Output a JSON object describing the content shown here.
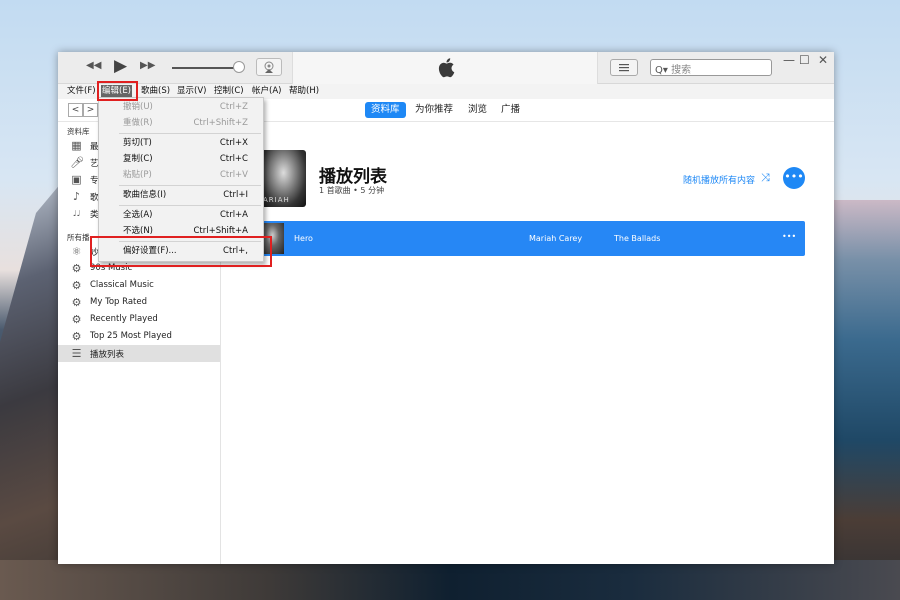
{
  "window": {
    "search_placeholder": "搜索",
    "apple_logo": "",
    "controls": {
      "minimize": "—",
      "maximize": "☐",
      "close": "✕"
    }
  },
  "playback": {
    "prev_icon": "◀◀",
    "play_icon": "▶",
    "next_icon": "▶▶",
    "volume": 1.0
  },
  "menubar": {
    "items": [
      {
        "label": "文件(F)"
      },
      {
        "label": "编辑(E)",
        "active": true
      },
      {
        "label": "歌曲(S)"
      },
      {
        "label": "显示(V)"
      },
      {
        "label": "控制(C)"
      },
      {
        "label": "帐户(A)"
      },
      {
        "label": "帮助(H)"
      }
    ]
  },
  "edit_menu": {
    "items": [
      {
        "label": "撤销(U)",
        "shortcut": "Ctrl+Z",
        "disabled": true
      },
      {
        "label": "重做(R)",
        "shortcut": "Ctrl+Shift+Z",
        "disabled": true
      },
      {
        "label": "剪切(T)",
        "shortcut": "Ctrl+X",
        "disabled": false
      },
      {
        "label": "复制(C)",
        "shortcut": "Ctrl+C",
        "disabled": false
      },
      {
        "label": "粘贴(P)",
        "shortcut": "Ctrl+V",
        "disabled": true
      },
      {
        "label": "歌曲信息(I)",
        "shortcut": "Ctrl+I",
        "disabled": false
      },
      {
        "label": "全选(A)",
        "shortcut": "Ctrl+A",
        "disabled": false
      },
      {
        "label": "不选(N)",
        "shortcut": "Ctrl+Shift+A",
        "disabled": false
      },
      {
        "label": "偏好设置(F)...",
        "shortcut": "Ctrl+,",
        "disabled": false
      }
    ]
  },
  "nav": {
    "back": "<",
    "forward": ">",
    "tabs": [
      {
        "label": "资料库",
        "active": true
      },
      {
        "label": "为你推荐"
      },
      {
        "label": "浏览"
      },
      {
        "label": "广播"
      }
    ]
  },
  "sidebar": {
    "library_heading": "资料库",
    "library_items": [
      {
        "icon": "grid-icon",
        "label": "最"
      },
      {
        "icon": "microphone-icon",
        "label": "艺"
      },
      {
        "icon": "album-icon",
        "label": "专"
      },
      {
        "icon": "music-note-icon",
        "label": "歌"
      },
      {
        "icon": "genre-icon",
        "label": "类"
      }
    ],
    "playlists_heading": "所有播",
    "playlists": [
      {
        "icon": "genius-icon",
        "label": "妙"
      },
      {
        "icon": "gear-icon",
        "label": "90s Music"
      },
      {
        "icon": "gear-icon",
        "label": "Classical Music"
      },
      {
        "icon": "gear-icon",
        "label": "My Top Rated"
      },
      {
        "icon": "gear-icon",
        "label": "Recently Played"
      },
      {
        "icon": "gear-icon",
        "label": "Top 25 Most Played"
      },
      {
        "icon": "playlist-icon",
        "label": "播放列表",
        "selected": true
      }
    ]
  },
  "playlist": {
    "title": "播放列表",
    "meta": "1 首歌曲 • 5 分钟",
    "art_text": "ARIAH",
    "shuffle_label": "随机播放所有内容",
    "more_icon": "•••",
    "songs": [
      {
        "title": "Hero",
        "artist": "Mariah Carey",
        "album": "The Ballads",
        "more": "•••"
      }
    ]
  },
  "colors": {
    "accent": "#1e88f5",
    "highlight_box": "#e02020"
  }
}
